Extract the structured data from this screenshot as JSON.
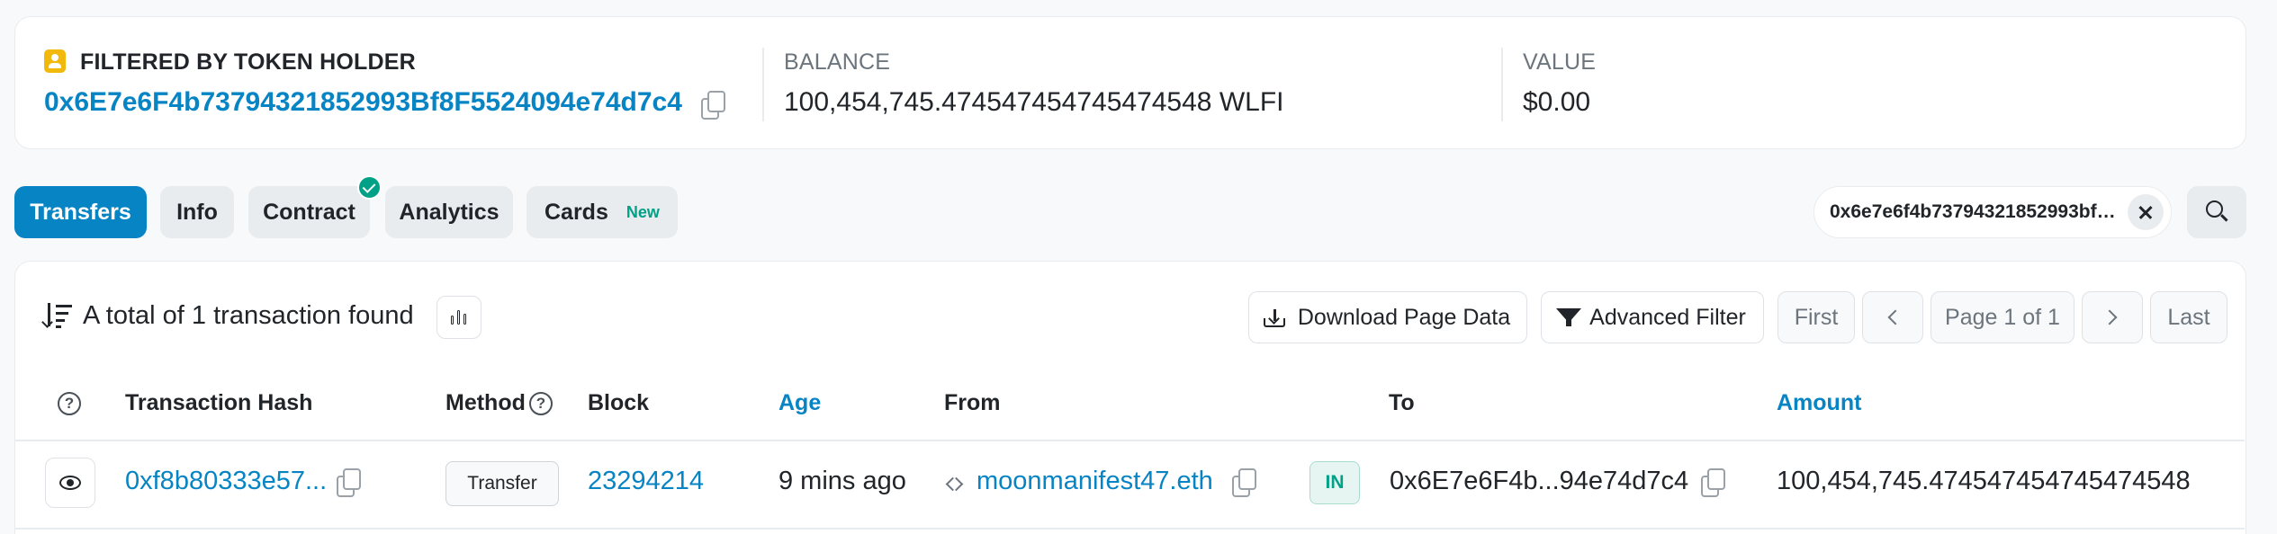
{
  "summary": {
    "holder_label": "FILTERED BY TOKEN HOLDER",
    "holder_address": "0x6E7e6F4b73794321852993Bf8F5524094e74d7c4",
    "balance_label": "BALANCE",
    "balance_value": "100,454,745.474547454745474548 WLFI",
    "value_label": "VALUE",
    "value_value": "$0.00"
  },
  "tabs": [
    {
      "label": "Transfers",
      "active": true
    },
    {
      "label": "Info"
    },
    {
      "label": "Contract",
      "verified": true
    },
    {
      "label": "Analytics"
    },
    {
      "label": "Cards",
      "badge": "New"
    }
  ],
  "filter": {
    "text": "0x6e7e6f4b73794321852993bf8f5524094e74d7c4"
  },
  "toolbar": {
    "total_text": "A total of 1 transaction found",
    "download_label": "Download Page Data",
    "advanced_filter_label": "Advanced Filter",
    "first_label": "First",
    "page_label": "Page 1 of 1",
    "last_label": "Last"
  },
  "table": {
    "headers": {
      "info": "?",
      "hash": "Transaction Hash",
      "method": "Method",
      "block": "Block",
      "age": "Age",
      "from": "From",
      "to": "To",
      "amount": "Amount"
    },
    "rows": [
      {
        "hash": "0xf8b80333e57...",
        "method": "Transfer",
        "block": "23294214",
        "age": "9 mins ago",
        "from": "moonmanifest47.eth",
        "direction": "IN",
        "to": "0x6E7e6F4b...94e74d7c4",
        "amount": "100,454,745.474547454745474548"
      }
    ]
  },
  "colors": {
    "accent": "#0784c3",
    "success": "#00a186",
    "holder_icon": "#f0b90b"
  }
}
